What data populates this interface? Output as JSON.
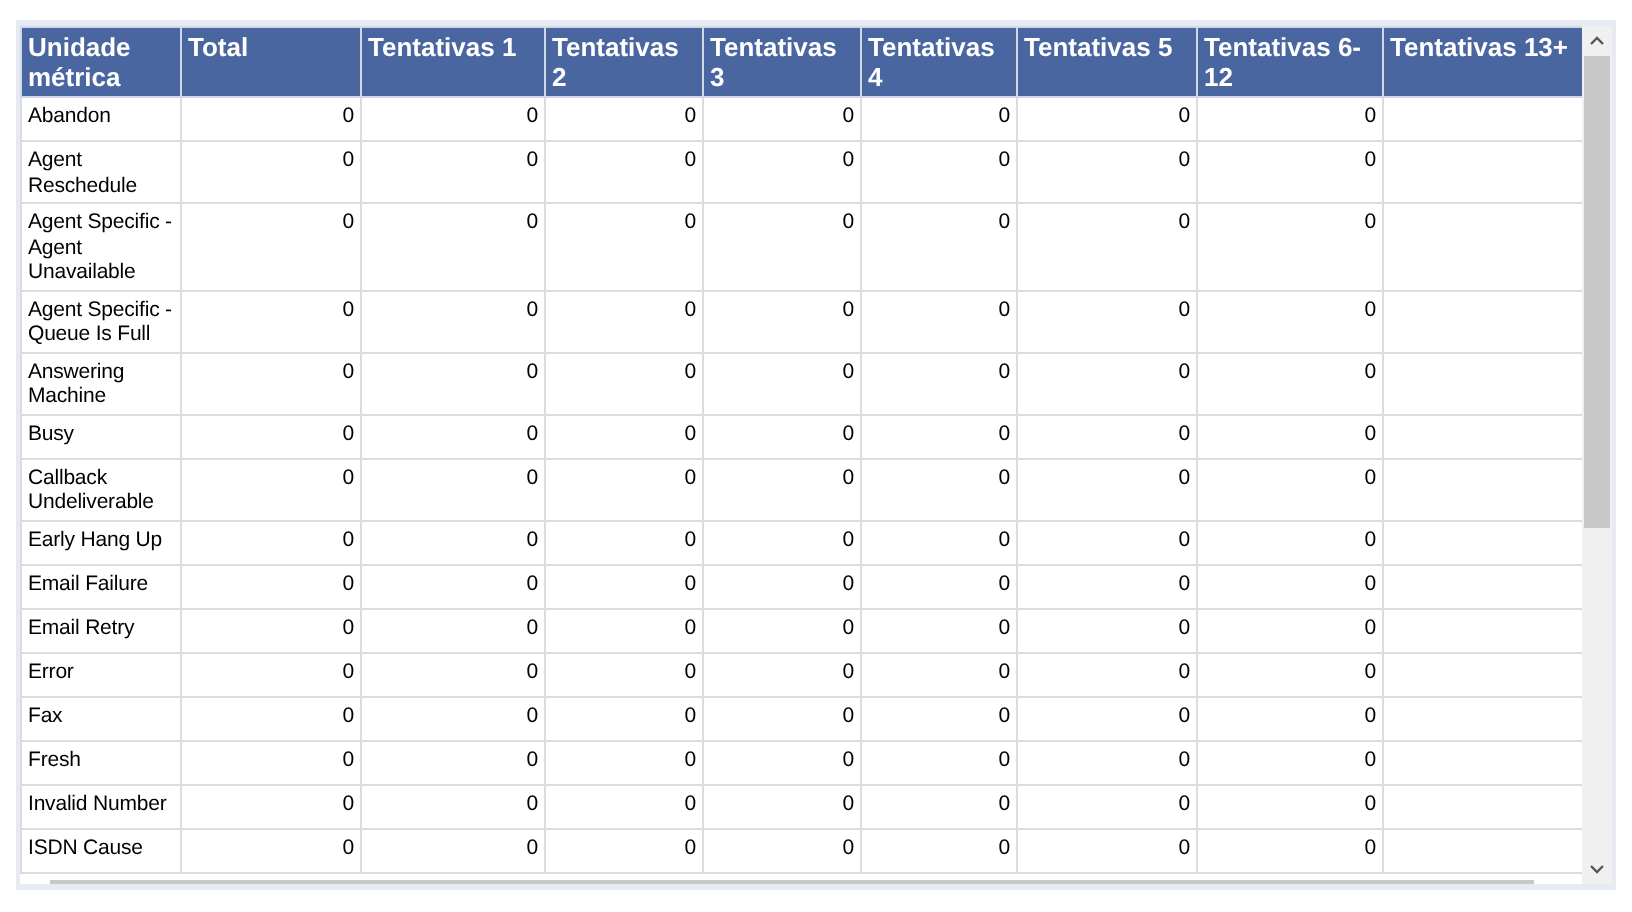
{
  "table": {
    "columns": [
      "Unidade métrica",
      "Total",
      "Tentativas 1",
      "Tentativas 2",
      "Tentativas 3",
      "Tentativas 4",
      "Tentativas 5",
      "Tentativas 6-12",
      "Tentativas 13+"
    ],
    "rows": [
      {
        "metric": "Abandon",
        "values": [
          "0",
          "0",
          "0",
          "0",
          "0",
          "0",
          "0"
        ]
      },
      {
        "metric": "Agent Reschedule",
        "values": [
          "0",
          "0",
          "0",
          "0",
          "0",
          "0",
          "0"
        ]
      },
      {
        "metric": "Agent Specific - Agent Unavailable",
        "values": [
          "0",
          "0",
          "0",
          "0",
          "0",
          "0",
          "0"
        ]
      },
      {
        "metric": "Agent Specific - Queue Is Full",
        "values": [
          "0",
          "0",
          "0",
          "0",
          "0",
          "0",
          "0"
        ]
      },
      {
        "metric": "Answering Machine",
        "values": [
          "0",
          "0",
          "0",
          "0",
          "0",
          "0",
          "0"
        ]
      },
      {
        "metric": "Busy",
        "values": [
          "0",
          "0",
          "0",
          "0",
          "0",
          "0",
          "0"
        ]
      },
      {
        "metric": "Callback Undeliverable",
        "values": [
          "0",
          "0",
          "0",
          "0",
          "0",
          "0",
          "0"
        ]
      },
      {
        "metric": "Early Hang Up",
        "values": [
          "0",
          "0",
          "0",
          "0",
          "0",
          "0",
          "0"
        ]
      },
      {
        "metric": "Email Failure",
        "values": [
          "0",
          "0",
          "0",
          "0",
          "0",
          "0",
          "0"
        ]
      },
      {
        "metric": "Email Retry",
        "values": [
          "0",
          "0",
          "0",
          "0",
          "0",
          "0",
          "0"
        ]
      },
      {
        "metric": "Error",
        "values": [
          "0",
          "0",
          "0",
          "0",
          "0",
          "0",
          "0"
        ]
      },
      {
        "metric": "Fax",
        "values": [
          "0",
          "0",
          "0",
          "0",
          "0",
          "0",
          "0"
        ]
      },
      {
        "metric": "Fresh",
        "values": [
          "0",
          "0",
          "0",
          "0",
          "0",
          "0",
          "0"
        ]
      },
      {
        "metric": "Invalid Number",
        "values": [
          "0",
          "0",
          "0",
          "0",
          "0",
          "0",
          "0"
        ]
      },
      {
        "metric": "ISDN Cause",
        "values": [
          "0",
          "0",
          "0",
          "0",
          "0",
          "0",
          "0"
        ]
      }
    ]
  }
}
